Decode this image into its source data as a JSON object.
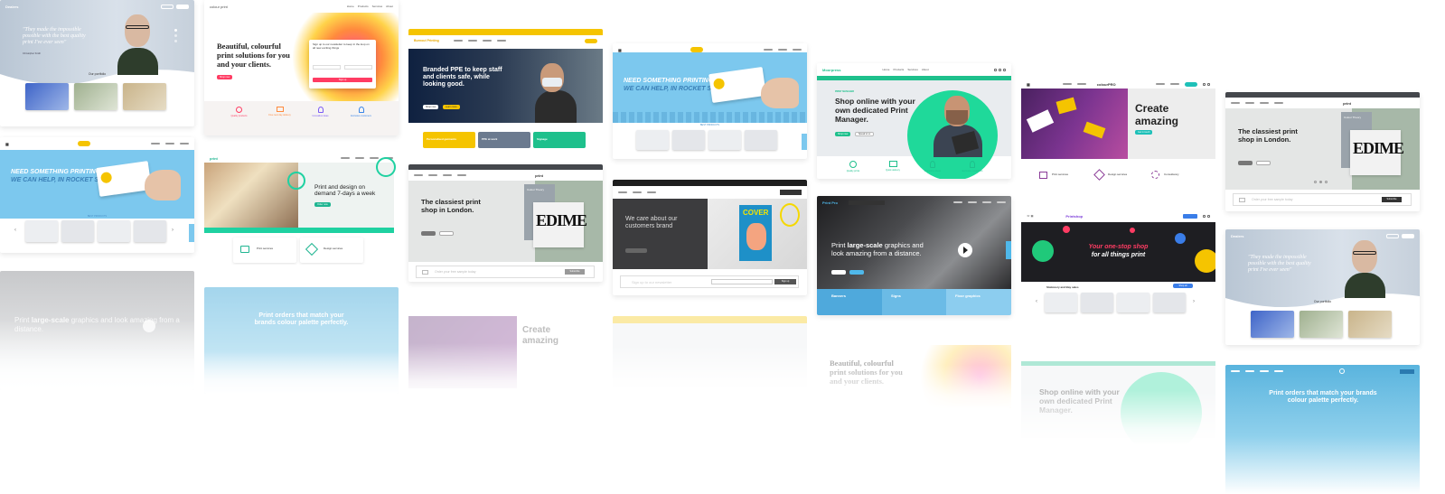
{
  "quote_card": {
    "logo": "Dealers",
    "quote": "\"They made the impossible possible with the best quality print I've ever seen\"",
    "author": "Christopher Smith",
    "portfolio_title": "Our portfolio"
  },
  "newsletter_card": {
    "logo": "colour print",
    "nav": [
      "Home",
      "Products",
      "Services",
      "About"
    ],
    "headline": "Beautiful, colourful print solutions for you and your clients.",
    "cta": "Shop now",
    "panel_title": "Sign up to our newsletter to keep in the loop on all new exciting things",
    "panel_button": "Sign up",
    "features": [
      "Quality products",
      "Free next day delivery",
      "Innovative ideas",
      "Exclusive customers"
    ]
  },
  "ppe_card": {
    "logo": "Burnout Printing",
    "headline": "Branded PPE to keep staff and clients safe, while looking good.",
    "buttons": [
      "Shop now",
      "Learn more"
    ],
    "tiles": [
      "Personalised garments",
      "PPE at work",
      "Signage"
    ],
    "colors": {
      "accent": "#f5c400",
      "teal": "#1ec08c",
      "slate": "#6b7a8f"
    }
  },
  "need_printing_card": {
    "headline_line1": "NEED SOMETHING PRINTING?",
    "headline_line2": "WE CAN HELP, IN ROCKET SPEED",
    "section_title": "BEST PRODUCTS"
  },
  "print_manager_card": {
    "logo": "Moorpress",
    "nav": [
      "Home",
      "Products",
      "Services",
      "About"
    ],
    "tag": "PRINT MANAGER",
    "headline": "Shop online with your own dedicated Print Manager.",
    "buttons": [
      "Shop now",
      "Speak to us"
    ],
    "features": [
      "Quality prints",
      "Quick delivery",
      "Innovative ideas",
      "Exclusive customers"
    ]
  },
  "create_amazing_card": {
    "logo": "colourPRO",
    "headline": "Create amazing",
    "features": [
      "Print services",
      "Design services",
      "Consultancy"
    ],
    "cta": "Get in touch"
  },
  "classiest_card": {
    "logo": "print",
    "headline": "The classiest print shop in London.",
    "book_title": "Colour Theory",
    "book_cover": "EDIME",
    "input_placeholder": "Order your free sample today",
    "button": "Subscribe"
  },
  "print_design_card": {
    "logo": "print",
    "headline": "Print and design on demand 7-days a week",
    "button": "Order now",
    "features": [
      "Print services",
      "Design services"
    ]
  },
  "customers_brand_card": {
    "headline": "We care about our customers brand",
    "magazine": "COVER",
    "input_placeholder": "Sign up to our newsletter",
    "button": "Sign up"
  },
  "large_scale_card": {
    "logo": "Print Pro",
    "headline_bold": "large-scale",
    "headline_pre": "Print",
    "headline_post": "graphics and look amazing from a distance.",
    "tiles": [
      "Banners",
      "Signs",
      "Floor graphics"
    ]
  },
  "one_stop_card": {
    "logo": "Printshop",
    "headline_line1": "Your one-stop shop",
    "headline_line2": "for all things print",
    "section_title": "Stationery and Bay sales",
    "button": "Shop all"
  },
  "colour_palette_card": {
    "headline": "Print orders that match your brands colour palette perfectly."
  }
}
